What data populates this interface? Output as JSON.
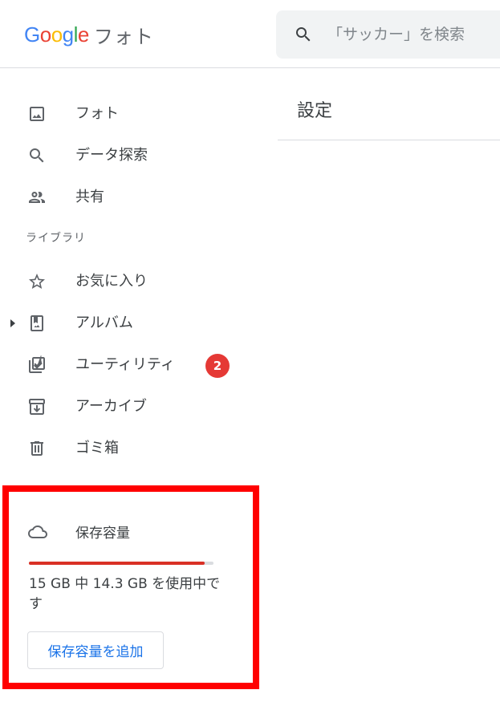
{
  "header": {
    "logo": {
      "letters": [
        "G",
        "o",
        "o",
        "g",
        "l",
        "e"
      ],
      "letter_colors": [
        "#4285f4",
        "#ea4335",
        "#fbbc05",
        "#4285f4",
        "#34a853",
        "#ea4335"
      ],
      "product": "フォト"
    },
    "search": {
      "icon": "search-icon",
      "placeholder": "「サッカー」を検索"
    }
  },
  "sidebar": {
    "items": [
      {
        "label": "フォト",
        "icon": "photo-icon"
      },
      {
        "label": "データ探索",
        "icon": "search-icon"
      },
      {
        "label": "共有",
        "icon": "people-icon"
      }
    ],
    "library_label": "ライブラリ",
    "library_items": [
      {
        "label": "お気に入り",
        "icon": "star-icon"
      },
      {
        "label": "アルバム",
        "icon": "album-icon",
        "expandable": true
      },
      {
        "label": "ユーティリティ",
        "icon": "utilities-icon",
        "badge": "2"
      },
      {
        "label": "アーカイブ",
        "icon": "archive-icon"
      },
      {
        "label": "ゴミ箱",
        "icon": "trash-icon"
      }
    ]
  },
  "main": {
    "title": "設定"
  },
  "storage": {
    "icon": "cloud-icon",
    "title": "保存容量",
    "usage_text": "15 GB 中 14.3 GB を使用中です",
    "used_fraction": 0.953,
    "add_button_label": "保存容量を追加",
    "colors": {
      "bar": "#d93025",
      "highlight": "#ff0000",
      "button_text": "#1a73e8",
      "badge": "#e53935"
    }
  }
}
